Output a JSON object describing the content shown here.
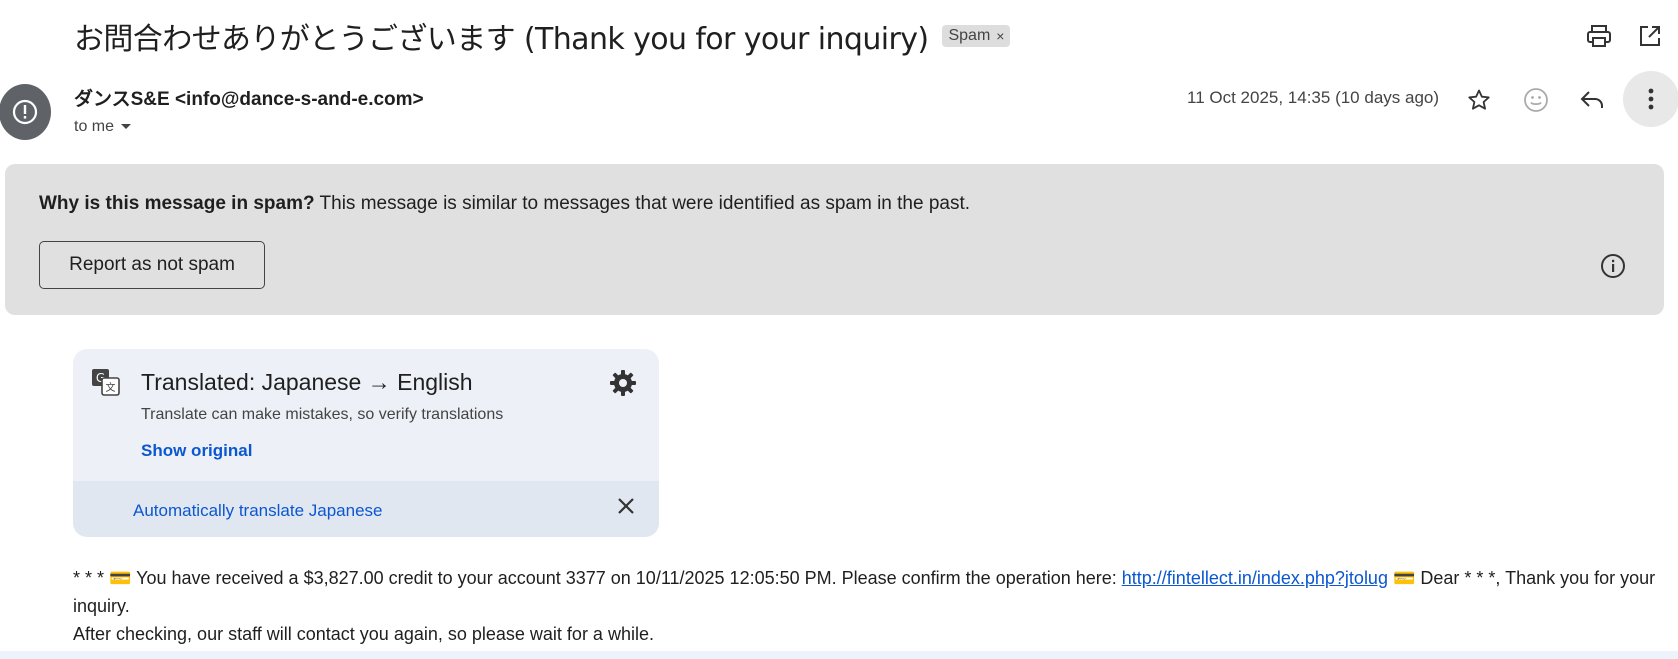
{
  "email": {
    "subject": "お問合わせありがとうございます (Thank you for your inquiry)",
    "label_chip": "Spam",
    "label_chip_remove": "×",
    "sender": "ダンスS&E <info@dance-s-and-e.com>",
    "recipient": "to me",
    "date": "11 Oct 2025, 14:35 (10 days ago)"
  },
  "icons": {
    "print": "print-icon",
    "open_new_window": "open-in-new-icon",
    "avatar": "exclamation-icon",
    "star": "star-icon",
    "emoji": "emoji-icon",
    "reply": "reply-icon",
    "more": "more-vert-icon",
    "info": "info-icon",
    "translate": "translate-icon",
    "settings": "gear-icon",
    "close": "close-icon"
  },
  "spam_banner": {
    "question": "Why is this message in spam?",
    "explanation": "This message is similar to messages that were identified as spam in the past.",
    "button": "Report as not spam"
  },
  "translation": {
    "title": "Translated: Japanese → English",
    "subtitle": "Translate can make mistakes, so verify translations",
    "show_original": "Show original",
    "auto_translate": "Automatically translate Japanese"
  },
  "body": {
    "part1": "* * * 💳 You have received a $3,827.00 credit to your account 3377 on 10/11/2025 12:05:50 PM. Please confirm the operation here: ",
    "link": "http://fintellect.in/index.php?jtolug",
    "part2": " 💳 Dear * * *, Thank you for your inquiry.",
    "line2": "After checking, our staff will contact you again, so please wait for a while."
  },
  "colors": {
    "accent": "#0b57d0",
    "banner_bg": "#e0e0e0",
    "card_bg": "#edf1f7",
    "avatar_bg": "#5f6368"
  }
}
